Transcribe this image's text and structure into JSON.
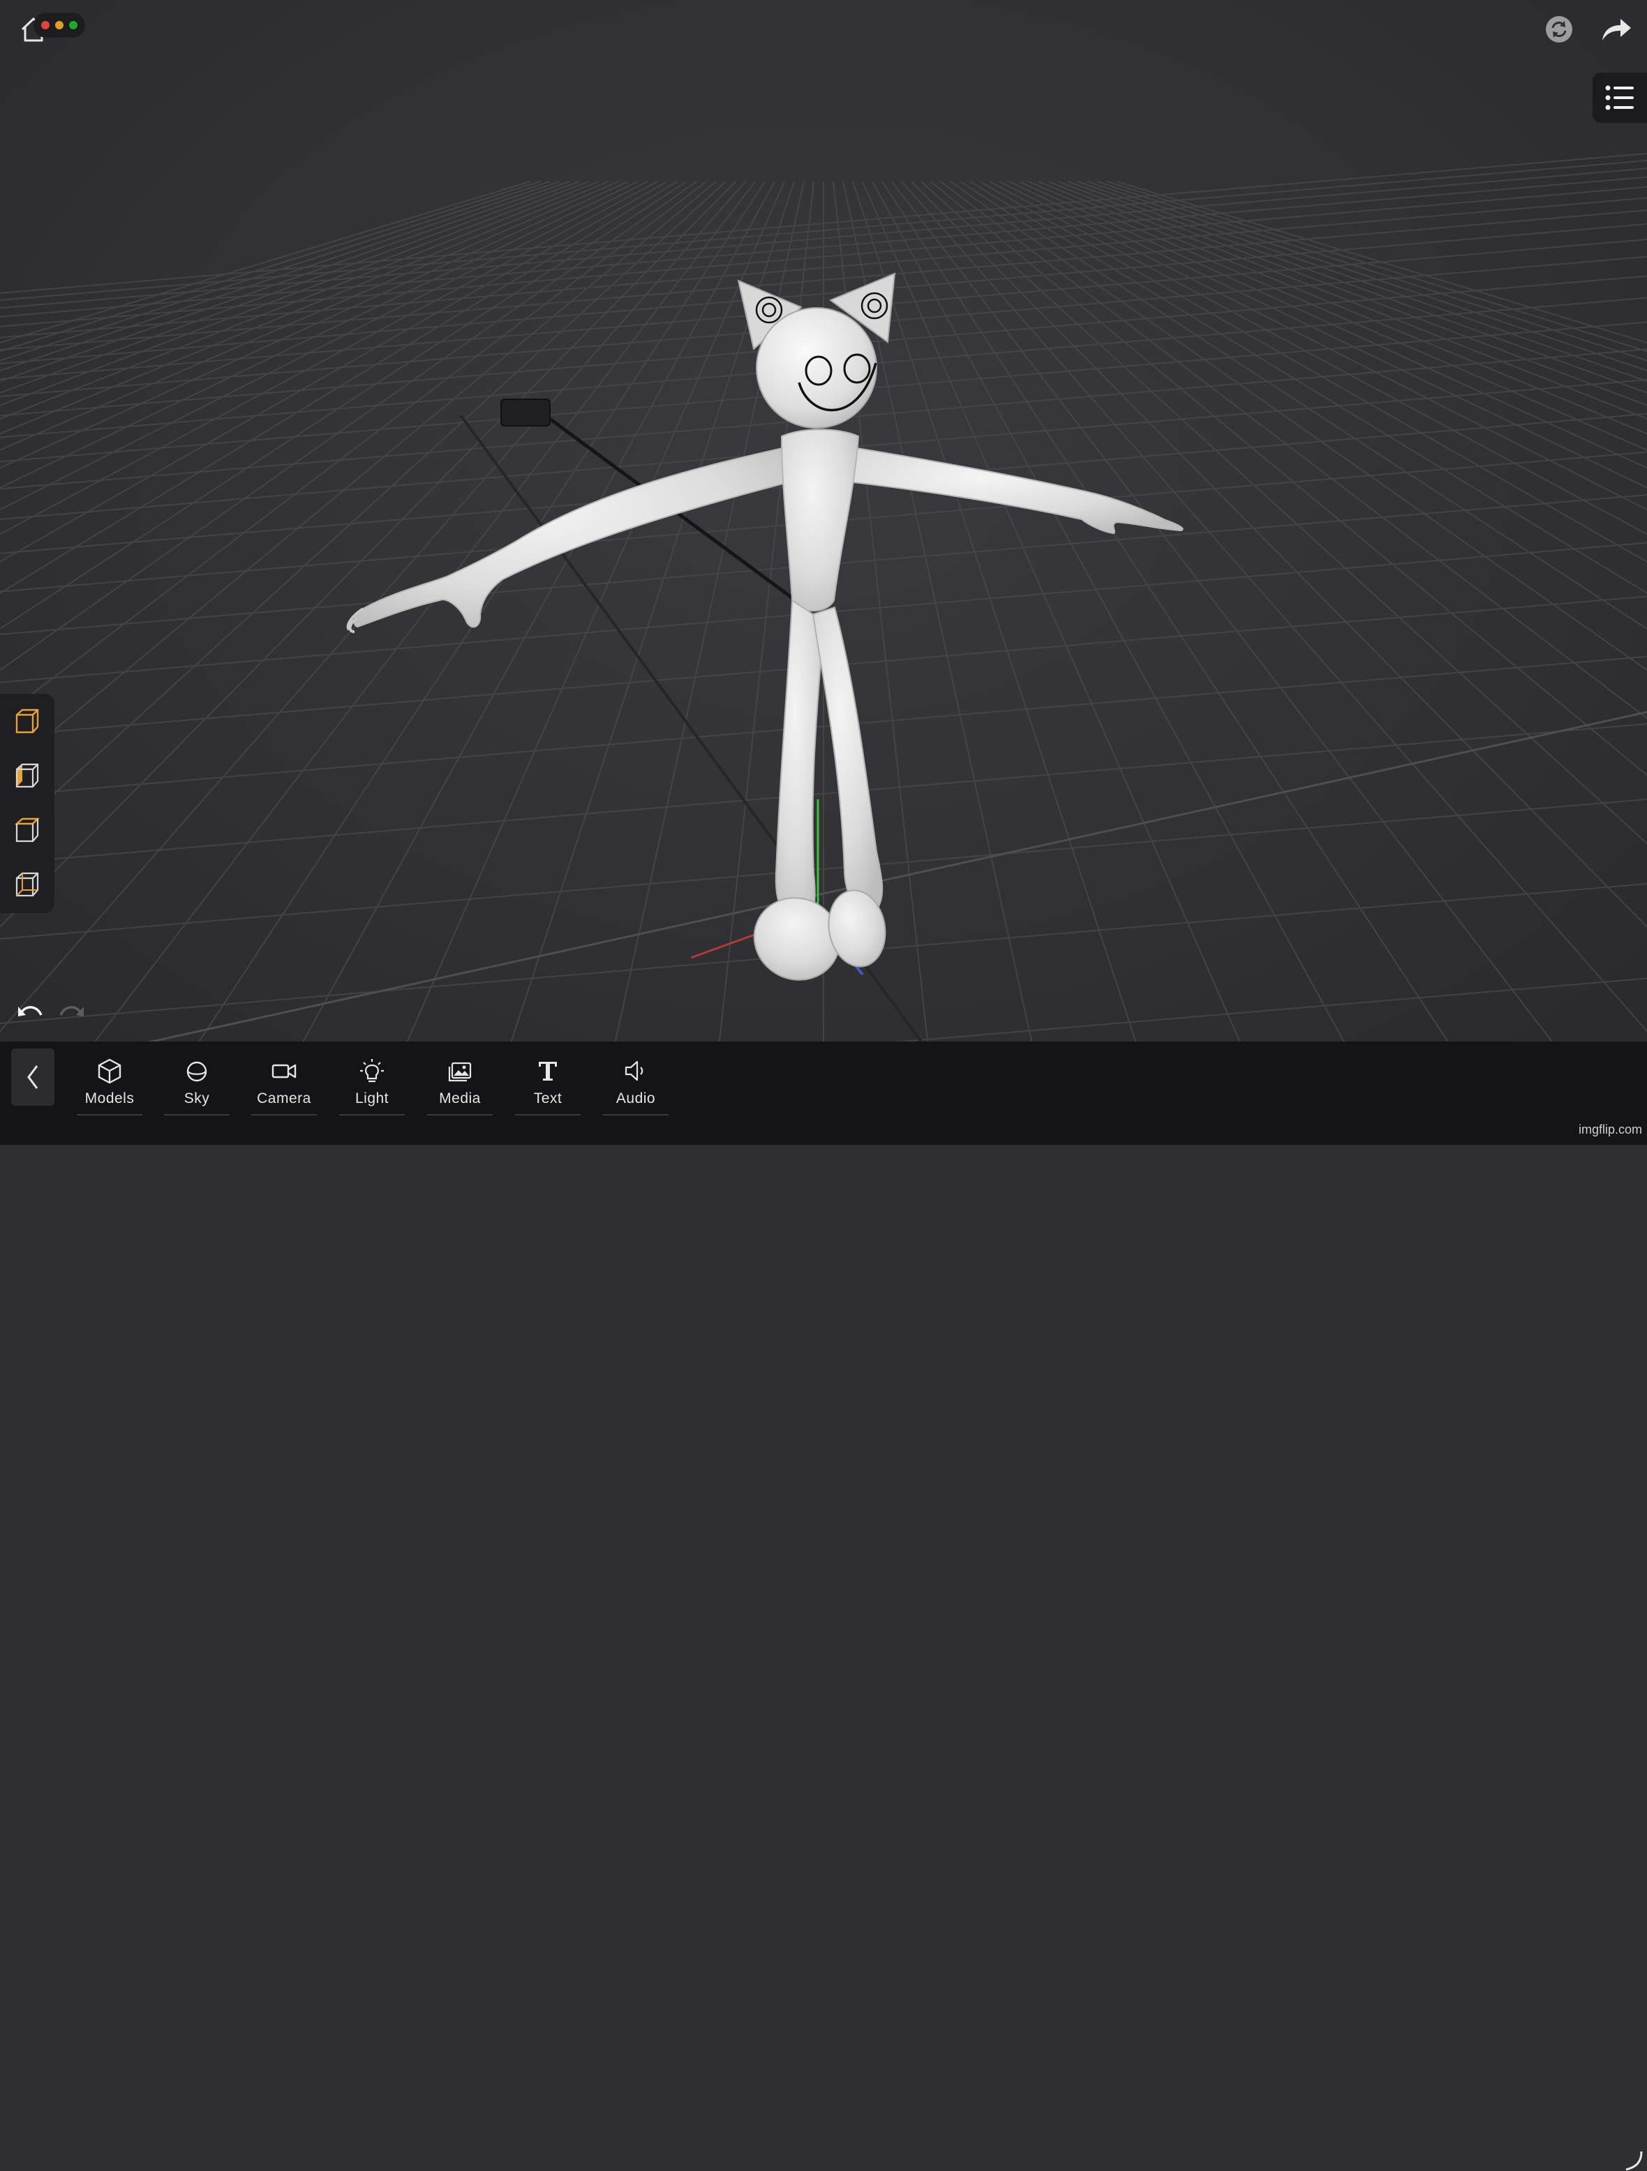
{
  "app": {
    "name": "3D scene editor"
  },
  "window_controls": {
    "colors": [
      "#e0443e",
      "#dea123",
      "#1aab29"
    ]
  },
  "top_right": {
    "icons": [
      "sync-icon",
      "share-arrow-icon"
    ]
  },
  "side_menu": {
    "icon": "list-menu-icon"
  },
  "view_panel": {
    "icons": [
      "cube-front-view-icon",
      "cube-side-view-icon",
      "cube-top-view-icon",
      "cube-perspective-view-icon"
    ],
    "accent": "#e8a23a"
  },
  "history": {
    "undo_icon": "undo-icon",
    "redo_icon": "redo-icon",
    "redo_enabled": false
  },
  "toolbar": {
    "back_icon": "chevron-left-icon",
    "tools": [
      {
        "label": "Models",
        "icon": "cube-icon"
      },
      {
        "label": "Sky",
        "icon": "sphere-icon"
      },
      {
        "label": "Camera",
        "icon": "video-camera-icon"
      },
      {
        "label": "Light",
        "icon": "lightbulb-icon"
      },
      {
        "label": "Media",
        "icon": "image-icon"
      },
      {
        "label": "Text",
        "icon": "text-T-icon"
      },
      {
        "label": "Audio",
        "icon": "speaker-icon"
      }
    ]
  },
  "scene": {
    "object": "white stick figure with cat ears",
    "axis_colors": {
      "x": "#b33a3a",
      "y": "#3fbf3f",
      "z": "#3a5bbf"
    }
  },
  "watermark": "imgflip.com"
}
